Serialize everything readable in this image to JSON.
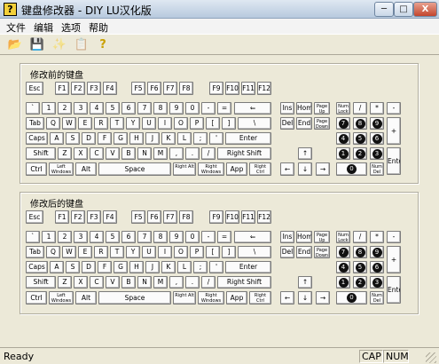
{
  "window": {
    "title": "键盘修改器 - DIY   LU汉化版",
    "icon": "app-key-icon"
  },
  "title_buttons": {
    "minimize": "─",
    "maximize": "□",
    "close": "X"
  },
  "menu": [
    "文件",
    "编辑",
    "选项",
    "帮助"
  ],
  "toolbar": [
    {
      "name": "open-icon",
      "glyph": "📂"
    },
    {
      "name": "save-icon",
      "glyph": "💾"
    },
    {
      "name": "magic-icon",
      "glyph": "✨"
    },
    {
      "name": "copy-icon",
      "glyph": "📋"
    },
    {
      "name": "help-icon",
      "glyph": "?"
    }
  ],
  "groups": [
    {
      "title": "修改前的键盘"
    },
    {
      "title": "修改后的键盘"
    }
  ],
  "keys": [
    "Esc",
    "F1",
    "F2",
    "F3",
    "F4",
    "F5",
    "F6",
    "F7",
    "F8",
    "F9",
    "F10",
    "F11",
    "F12",
    "`",
    "1",
    "2",
    "3",
    "4",
    "5",
    "6",
    "7",
    "8",
    "9",
    "0",
    "-",
    "=",
    "⇐",
    "Tab",
    "Q",
    "W",
    "E",
    "R",
    "T",
    "Y",
    "U",
    "I",
    "O",
    "P",
    "[",
    "]",
    "\\",
    "Caps",
    "A",
    "S",
    "D",
    "F",
    "G",
    "H",
    "J",
    "K",
    "L",
    ";",
    "'",
    "Enter",
    "Shift",
    "Z",
    "X",
    "C",
    "V",
    "B",
    "N",
    "M",
    ",",
    ".",
    "/",
    "Right Shift",
    "Ctrl",
    "Left Windows",
    "Alt",
    "Space",
    "Right Alt",
    "Right Windows",
    "App",
    "Right Ctrl",
    "Ins",
    "Home",
    "Page Up",
    "Del",
    "End",
    "Page Down",
    "↑",
    "←",
    "↓",
    "→",
    "Num Lock",
    "/",
    "*",
    "-",
    "7",
    "8",
    "9",
    "+",
    "4",
    "5",
    "6",
    "1",
    "2",
    "3",
    "Enter",
    "0",
    "Num Del"
  ],
  "status": {
    "text": "Ready",
    "cap": "CAP",
    "num": "NUM"
  }
}
